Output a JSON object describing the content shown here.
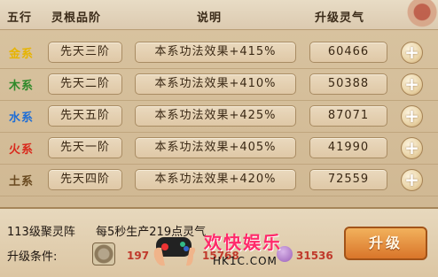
{
  "header": {
    "col_element": "五行",
    "col_rank": "灵根品阶",
    "col_desc": "说明",
    "col_value": "升级灵气"
  },
  "rows": [
    {
      "element": "金系",
      "color": "#e7b400",
      "rank": "先天三阶",
      "desc": "本系功法效果+415%",
      "value": "60466"
    },
    {
      "element": "木系",
      "color": "#2f8a2b",
      "rank": "先天二阶",
      "desc": "本系功法效果+410%",
      "value": "50388"
    },
    {
      "element": "水系",
      "color": "#1e6ed6",
      "rank": "先天五阶",
      "desc": "本系功法效果+425%",
      "value": "87071"
    },
    {
      "element": "火系",
      "color": "#d9291c",
      "rank": "先天一阶",
      "desc": "本系功法效果+405%",
      "value": "41990"
    },
    {
      "element": "土系",
      "color": "#6a4a20",
      "rank": "先天四阶",
      "desc": "本系功法效果+420%",
      "value": "72559"
    }
  ],
  "bottom": {
    "formation": "113级聚灵阵",
    "production": "每5秒生产219点灵气",
    "condition_label": "升级条件:",
    "cost1": "197",
    "cost2": "15768",
    "cost3": "31536",
    "upgrade_label": "升级"
  },
  "watermark": {
    "text": "欢快娱乐",
    "url": "HK1C.COM"
  }
}
